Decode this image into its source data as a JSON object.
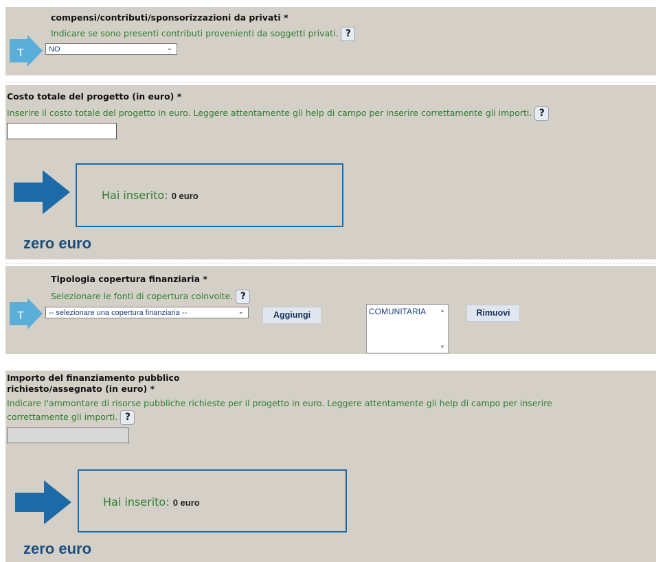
{
  "section_private": {
    "title": "compensi/contributi/sponsorizzazioni da privati *",
    "hint": "Indicare se sono presenti contributi provenienti da soggetti privati.",
    "help_icon_text": "?",
    "select_value": "NO",
    "t_badge": "T"
  },
  "section_cost": {
    "title": "Costo totale del progetto (in euro) *",
    "hint": "Inserire il costo totale del progetto in euro. Leggere attentamente gli help di campo per inserire correttamente gli importi.",
    "help_icon_text": "?",
    "input_value": "",
    "inserted_label": "Hai inserito:",
    "inserted_value": "0 euro",
    "amount_words": "zero euro"
  },
  "section_coverage": {
    "title": "Tipologia copertura finanziaria *",
    "hint": "Selezionare le fonti di copertura coinvolte.",
    "help_icon_text": "?",
    "select_value": "-- selezionare una copertura finanziaria --",
    "add_button": "Aggiungi",
    "selected_items": [
      "COMUNITARIA"
    ],
    "remove_button": "Rimuovi",
    "t_badge": "T"
  },
  "section_public": {
    "title_line1": "Importo del finanziamento pubblico",
    "title_line2": "richiesto/assegnato (in euro) *",
    "hint_line1": "Indicare l'ammontare di risorse pubbliche richieste per il progetto in euro. Leggere attentamente gli help di campo per inserire",
    "hint_line2": "correttamente gli importi.",
    "help_icon_text": "?",
    "input_value": "",
    "inserted_label": "Hai inserito:",
    "inserted_value": "0 euro",
    "amount_words": "zero euro"
  },
  "colors": {
    "panel_bg": "#d4d0c8",
    "hint_green": "#2e7d2e",
    "arrow_blue": "#1c6aa8",
    "badge_blue": "#5aaed8"
  }
}
